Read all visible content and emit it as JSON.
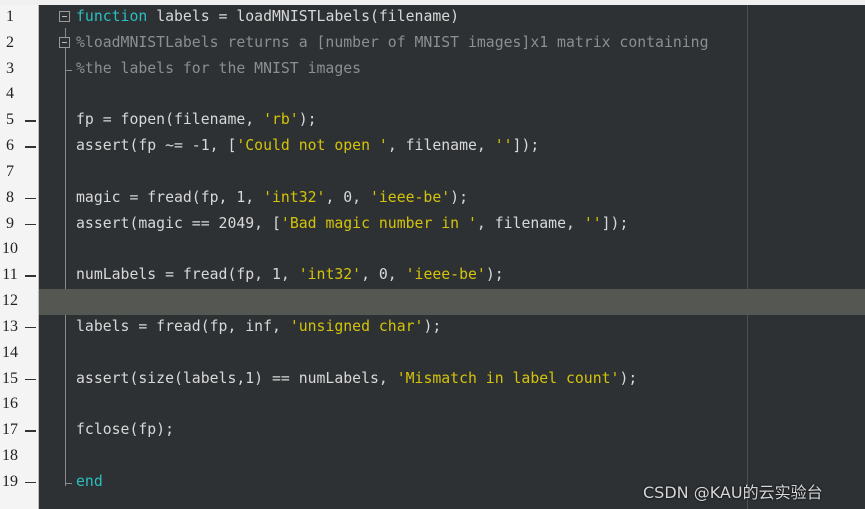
{
  "editor": {
    "current_line": 12,
    "colors": {
      "background": "#2d3134",
      "keyword": "#2bbfbf",
      "comment": "#8a8f8f",
      "string": "#d4c30a",
      "text": "#d8d8d8",
      "current_line": "#555752"
    },
    "lines": [
      {
        "n": "1",
        "exec": false,
        "fold": "start",
        "tokens": [
          [
            "kw",
            "function"
          ],
          [
            "tx",
            " labels = loadMNISTLabels(filename)"
          ]
        ]
      },
      {
        "n": "2",
        "exec": false,
        "fold": "start",
        "tokens": [
          [
            "cm",
            "%loadMNISTLabels returns a [number of MNIST images]x1 matrix containing"
          ]
        ]
      },
      {
        "n": "3",
        "exec": false,
        "fold": "end",
        "tokens": [
          [
            "cm",
            "%the labels for the MNIST images"
          ]
        ]
      },
      {
        "n": "4",
        "exec": false,
        "tokens": []
      },
      {
        "n": "5",
        "exec": true,
        "tokens": [
          [
            "tx",
            "fp = fopen(filename, "
          ],
          [
            "str",
            "'rb'"
          ],
          [
            "tx",
            ");"
          ]
        ]
      },
      {
        "n": "6",
        "exec": true,
        "tokens": [
          [
            "tx",
            "assert(fp ~= -1, ["
          ],
          [
            "str",
            "'Could not open '"
          ],
          [
            "tx",
            ", filename, "
          ],
          [
            "str",
            "''"
          ],
          [
            "tx",
            "]);"
          ]
        ]
      },
      {
        "n": "7",
        "exec": false,
        "tokens": []
      },
      {
        "n": "8",
        "exec": true,
        "tokens": [
          [
            "tx",
            "magic = fread(fp, 1, "
          ],
          [
            "str",
            "'int32'"
          ],
          [
            "tx",
            ", 0, "
          ],
          [
            "str",
            "'ieee-be'"
          ],
          [
            "tx",
            ");"
          ]
        ]
      },
      {
        "n": "9",
        "exec": true,
        "tokens": [
          [
            "tx",
            "assert(magic == 2049, ["
          ],
          [
            "str",
            "'Bad magic number in '"
          ],
          [
            "tx",
            ", filename, "
          ],
          [
            "str",
            "''"
          ],
          [
            "tx",
            "]);"
          ]
        ]
      },
      {
        "n": "10",
        "exec": false,
        "tokens": []
      },
      {
        "n": "11",
        "exec": true,
        "tokens": [
          [
            "tx",
            "numLabels = fread(fp, 1, "
          ],
          [
            "str",
            "'int32'"
          ],
          [
            "tx",
            ", 0, "
          ],
          [
            "str",
            "'ieee-be'"
          ],
          [
            "tx",
            ");"
          ]
        ]
      },
      {
        "n": "12",
        "exec": false,
        "tokens": []
      },
      {
        "n": "13",
        "exec": true,
        "tokens": [
          [
            "tx",
            "labels = fread(fp, inf, "
          ],
          [
            "str",
            "'unsigned char'"
          ],
          [
            "tx",
            ");"
          ]
        ]
      },
      {
        "n": "14",
        "exec": false,
        "tokens": []
      },
      {
        "n": "15",
        "exec": true,
        "tokens": [
          [
            "tx",
            "assert(size(labels,1) == numLabels, "
          ],
          [
            "str",
            "'Mismatch in label count'"
          ],
          [
            "tx",
            ");"
          ]
        ]
      },
      {
        "n": "16",
        "exec": false,
        "tokens": []
      },
      {
        "n": "17",
        "exec": true,
        "tokens": [
          [
            "tx",
            "fclose(fp);"
          ]
        ]
      },
      {
        "n": "18",
        "exec": false,
        "tokens": []
      },
      {
        "n": "19",
        "exec": true,
        "fold": "end",
        "tokens": [
          [
            "kw",
            "end"
          ]
        ]
      }
    ]
  },
  "watermark": "CSDN @KAU的云实验台"
}
